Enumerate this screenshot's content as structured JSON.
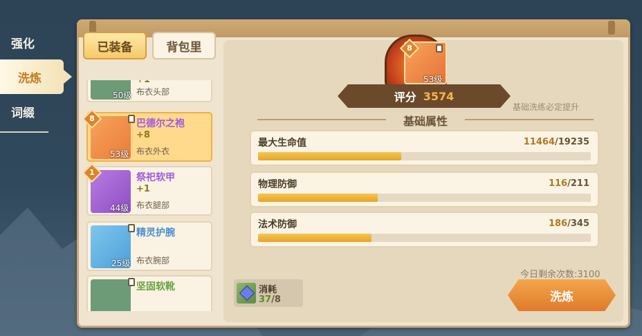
{
  "side_tabs": [
    {
      "label": "强化"
    },
    {
      "label": "洗炼"
    },
    {
      "label": "词缀"
    }
  ],
  "sub_tabs": {
    "equipped": "已装备",
    "bag": "背包里"
  },
  "items": [
    {
      "name": "",
      "plus": "+1",
      "level": "50级",
      "slot": "布衣头部",
      "color": "#2d8a5a"
    },
    {
      "name": "巴德尔之袍",
      "plus": "+8",
      "level": "53级",
      "slot": "布衣外衣",
      "badge": "8",
      "color": "#a05be0"
    },
    {
      "name": "祭祀软甲",
      "plus": "+1",
      "level": "44级",
      "slot": "布衣腿部",
      "badge": "1",
      "color": "#a05be0"
    },
    {
      "name": "精灵护腕",
      "plus": "",
      "level": "25级",
      "slot": "布衣腕部",
      "color": "#4e8fd0"
    },
    {
      "name": "坚固软靴",
      "plus": "",
      "level": "",
      "slot": "",
      "color": "#6aa040"
    }
  ],
  "equip": {
    "badge": "8",
    "level": "53级"
  },
  "score": {
    "label": "评分",
    "value": "3574"
  },
  "hint": "基础洗练必定提升",
  "section_title": "基础属性",
  "attributes": [
    {
      "name": "最大生命值",
      "current": "11464",
      "max": "19235",
      "progress": 0.43
    },
    {
      "name": "物理防御",
      "current": "116",
      "max": "211",
      "progress": 0.36
    },
    {
      "name": "法术防御",
      "current": "186",
      "max": "345",
      "progress": 0.34
    }
  ],
  "cost": {
    "label": "消耗",
    "have": "37",
    "need": "8",
    "sep": "/"
  },
  "remaining": "今日剩余次数:3100",
  "refine_button": "洗炼",
  "colors": {
    "accent": "#e07a2a",
    "bar": "#e6a52a",
    "selected": "#ffd98c"
  }
}
